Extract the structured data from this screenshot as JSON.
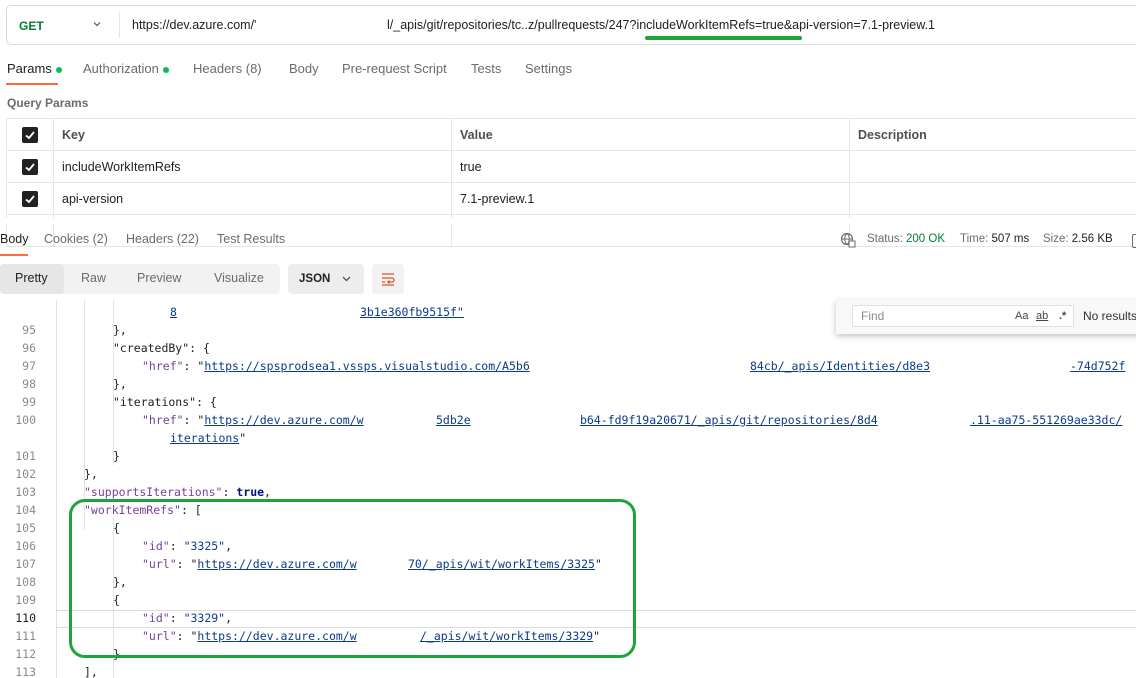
{
  "request": {
    "method": "GET",
    "url_start": "https://dev.azure.com/'",
    "url_end": "l/_apis/git/repositories/tc..z/pullrequests/247?includeWorkItemRefs=true&api-version=7.1-preview.1"
  },
  "request_tabs": [
    {
      "label": "Params",
      "dot": true
    },
    {
      "label": "Authorization",
      "dot": true
    },
    {
      "label": "Headers (8)"
    },
    {
      "label": "Body"
    },
    {
      "label": "Pre-request Script"
    },
    {
      "label": "Tests"
    },
    {
      "label": "Settings"
    }
  ],
  "query_params_title": "Query Params",
  "params_table": {
    "headers": [
      "Key",
      "Value",
      "Description"
    ],
    "rows": [
      {
        "key": "includeWorkItemRefs",
        "value": "true"
      },
      {
        "key": "api-version",
        "value": "7.1-preview.1"
      }
    ]
  },
  "response_tabs": [
    "Body",
    "Cookies (2)",
    "Headers (22)",
    "Test Results"
  ],
  "status": {
    "status_label": "Status:",
    "status_value": "200 OK",
    "time_label": "Time:",
    "time_value": "507 ms",
    "size_label": "Size:",
    "size_value": "2.56 KB"
  },
  "view_tabs": [
    "Pretty",
    "Raw",
    "Preview",
    "Visualize"
  ],
  "format": "JSON",
  "find": {
    "placeholder": "Find",
    "match_case": "Aa",
    "whole_word": "ab",
    "regex": ".*",
    "results": "No results"
  },
  "code_lines": [
    {
      "n": "",
      "t": ""
    },
    {
      "n": "95",
      "t": "},"
    },
    {
      "n": "96",
      "t": "\"createdBy\": {"
    },
    {
      "n": "97",
      "t": "\"href\": \"https://spsprodsea1.vssps.visualstudio.com/A5b6 84cb/_apis/Identities/d8e3 -74d752f\""
    },
    {
      "n": "98",
      "t": "},"
    },
    {
      "n": "99",
      "t": "\"iterations\": {"
    },
    {
      "n": "100",
      "t": "\"href\": \"https://dev.azure.com/w 5db2e b64-fd9f19a20671/_apis/git/repositories/8d4 .11-aa75-551269ae33dc/iterations\""
    },
    {
      "n": "101",
      "t": "}"
    },
    {
      "n": "102",
      "t": "},"
    },
    {
      "n": "103",
      "t": "\"supportsIterations\": true,"
    },
    {
      "n": "104",
      "t": "\"workItemRefs\": ["
    },
    {
      "n": "105",
      "t": "{"
    },
    {
      "n": "106",
      "t": "\"id\": \"3325\","
    },
    {
      "n": "107",
      "t": "\"url\": \"https://dev.azure.com/w 70/_apis/wit/workItems/3325\""
    },
    {
      "n": "108",
      "t": "},"
    },
    {
      "n": "109",
      "t": "{"
    },
    {
      "n": "110",
      "t": "\"id\": \"3329\","
    },
    {
      "n": "111",
      "t": "\"url\": \"https://dev.azure.com/w /_apis/wit/workItems/3329\""
    },
    {
      "n": "112",
      "t": "}"
    },
    {
      "n": "113",
      "t": "],"
    }
  ],
  "code_fragments": {
    "line94_a": "8",
    "line94_b": "3b1e360fb9515f\"",
    "l97_key": "\"href\"",
    "l97_a": "https://spsprodsea1.vssps.visualstudio.com/A5b6",
    "l97_b": "84cb/_apis/Identities/d8e3",
    "l97_c": "-74d752f",
    "l100_a": "https://dev.azure.com/w",
    "l100_b": "5db2e",
    "l100_c": "b64-fd9f19a20671/_apis/git/repositories/8d4",
    "l100_d": ".11-aa75-551269ae33dc/",
    "l100_e": "iterations",
    "l107_a": "https://dev.azure.com/w",
    "l107_b": "70/_apis/wit/workItems/3325",
    "l111_a": "https://dev.azure.com/w",
    "l111_b": "/_apis/wit/workItems/3329"
  }
}
